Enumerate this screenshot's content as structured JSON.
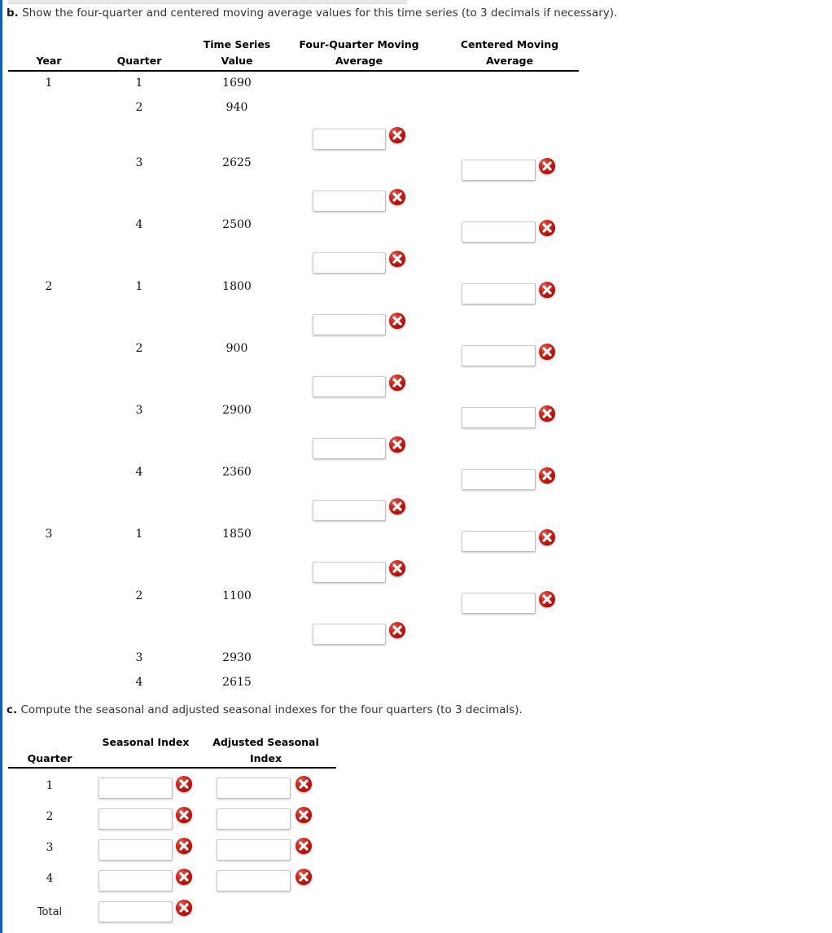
{
  "part_b": {
    "lead": "b.",
    "text": "Show the four-quarter and centered moving average values for this time series (to 3 decimals if necessary).",
    "headers": {
      "year": "Year",
      "quarter": "Quarter",
      "time_series_value_l1": "Time Series",
      "time_series_value_l2": "Value",
      "four_quarter_l1": "Four-Quarter Moving",
      "four_quarter_l2": "Average",
      "centered_l1": "Centered Moving",
      "centered_l2": "Average"
    },
    "rows": [
      {
        "year": "1",
        "quarter": "1",
        "value": "1690"
      },
      {
        "year": "",
        "quarter": "2",
        "value": "940"
      },
      {
        "year": "",
        "quarter": "3",
        "value": "2625"
      },
      {
        "year": "",
        "quarter": "4",
        "value": "2500"
      },
      {
        "year": "2",
        "quarter": "1",
        "value": "1800"
      },
      {
        "year": "",
        "quarter": "2",
        "value": "900"
      },
      {
        "year": "",
        "quarter": "3",
        "value": "2900"
      },
      {
        "year": "",
        "quarter": "4",
        "value": "2360"
      },
      {
        "year": "3",
        "quarter": "1",
        "value": "1850"
      },
      {
        "year": "",
        "quarter": "2",
        "value": "1100"
      },
      {
        "year": "",
        "quarter": "3",
        "value": "2930"
      },
      {
        "year": "",
        "quarter": "4",
        "value": "2615"
      }
    ],
    "four_quarter_inputs": [
      "",
      "",
      "",
      "",
      "",
      "",
      "",
      "",
      "",
      ""
    ],
    "centered_inputs": [
      "",
      "",
      "",
      "",
      "",
      "",
      "",
      ""
    ],
    "status_icon": "error-x-icon"
  },
  "part_c": {
    "lead": "c.",
    "text": "Compute the seasonal and adjusted seasonal indexes for the four quarters (to 3 decimals).",
    "headers": {
      "quarter": "Quarter",
      "seasonal_index": "Seasonal Index",
      "adjusted_l1": "Adjusted Seasonal",
      "adjusted_l2": "Index"
    },
    "rows": [
      {
        "quarter": "1",
        "seasonal_index": "",
        "adjusted_index": ""
      },
      {
        "quarter": "2",
        "seasonal_index": "",
        "adjusted_index": ""
      },
      {
        "quarter": "3",
        "seasonal_index": "",
        "adjusted_index": ""
      },
      {
        "quarter": "4",
        "seasonal_index": "",
        "adjusted_index": ""
      }
    ],
    "total_label": "Total",
    "total_value": "",
    "status_icon": "error-x-icon"
  },
  "colors": {
    "accent_bar": "#1560bd",
    "error_red": "#cf2017",
    "rule": "#000000"
  }
}
